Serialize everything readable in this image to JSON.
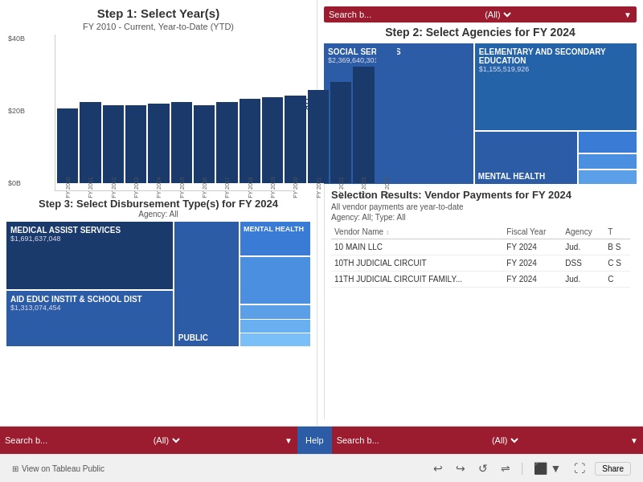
{
  "step1": {
    "title": "Step 1: Select Year(s)",
    "subtitle": "FY 2010 - Current, Year-to-Date (YTD)",
    "y_axis": {
      "top": "$40B",
      "mid": "$20B",
      "bottom": "$0B"
    },
    "bars": [
      {
        "label": "FY 2010",
        "height": 48,
        "ytd": false
      },
      {
        "label": "FY 2011",
        "height": 52,
        "ytd": false
      },
      {
        "label": "FY 2012",
        "height": 50,
        "ytd": false
      },
      {
        "label": "FY 2013",
        "height": 50,
        "ytd": false
      },
      {
        "label": "FY 2014",
        "height": 51,
        "ytd": false
      },
      {
        "label": "FY 2015",
        "height": 52,
        "ytd": false
      },
      {
        "label": "FY 2016",
        "height": 50,
        "ytd": false
      },
      {
        "label": "FY 2017",
        "height": 52,
        "ytd": false
      },
      {
        "label": "FY 2018",
        "height": 54,
        "ytd": false
      },
      {
        "label": "FY 2019",
        "height": 55,
        "ytd": false
      },
      {
        "label": "FY 2020",
        "height": 56,
        "ytd": false
      },
      {
        "label": "FY 2021",
        "height": 60,
        "ytd": false
      },
      {
        "label": "FY 2022",
        "height": 65,
        "ytd": false
      },
      {
        "label": "FY 2023",
        "height": 75,
        "ytd": false
      },
      {
        "label": "FY 2024",
        "height": 88,
        "ytd": true
      }
    ],
    "ytd_label": "YTD"
  },
  "step2": {
    "title": "Step 2: Select Agencies for FY 2024",
    "search_label": "Search b...",
    "search_default": "(All)",
    "agencies": [
      {
        "name": "SOCIAL SERVICES",
        "value": "$2,369,640,301"
      },
      {
        "name": "ELEMENTARY AND SECONDARY EDUCATION",
        "value": "$1,155,519,926"
      },
      {
        "name": "MENTAL HEALTH",
        "value": ""
      }
    ]
  },
  "step3": {
    "title": "Step 3: Select Disbursement Type(s) for FY 2024",
    "subtitle": "Agency: All",
    "items": [
      {
        "name": "MEDICAL ASSIST SERVICES",
        "value": "$1,691,637,048"
      },
      {
        "name": "AID EDUC INSTIT & SCHOOL DIST",
        "value": "$1,313,074,454"
      },
      {
        "name": "PUBLIC",
        "value": ""
      },
      {
        "name": "MENTAL HEALTH",
        "value": ""
      }
    ]
  },
  "results": {
    "title": "Selection Results: Vendor Payments for FY 2024",
    "subtitle": "All vendor payments are year-to-date",
    "subtitle2": "Agency: All; Type: All",
    "columns": [
      "Vendor Name",
      "↕",
      "Fiscal Year",
      "Agency",
      "T"
    ],
    "rows": [
      {
        "vendor": "10 MAIN LLC",
        "year": "FY 2024",
        "agency": "Jud.",
        "type": "B S"
      },
      {
        "vendor": "10TH JUDICIAL CIRCUIT",
        "year": "FY 2024",
        "agency": "DSS",
        "type": "C S"
      },
      {
        "vendor": "11TH JUDICIAL CIRCUIT FAMILY...",
        "year": "FY 2024",
        "agency": "Jud.",
        "type": "C"
      }
    ]
  },
  "bottom": {
    "search_left": {
      "label": "Search b...",
      "default": "(All)"
    },
    "help_label": "Help",
    "search_right": {
      "label": "Search b...",
      "default": "(All)"
    }
  },
  "footer": {
    "view_label": "View on Tableau Public",
    "share_label": "Share"
  }
}
